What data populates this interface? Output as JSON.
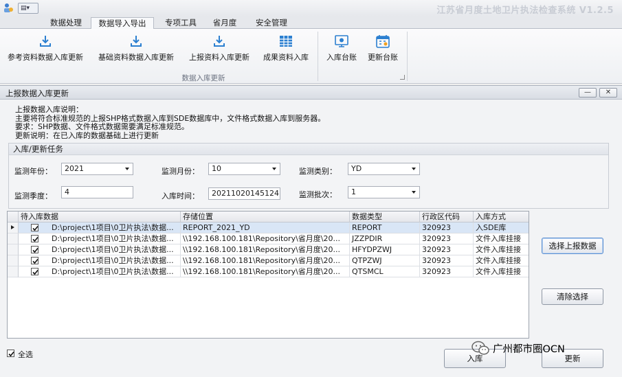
{
  "app": {
    "title": "江苏省月度土地卫片执法检查系统 V1.2.5",
    "quick_access": "▤▾"
  },
  "ribbon": {
    "tabs": [
      {
        "label": "数据处理",
        "active": false
      },
      {
        "label": "数据导入导出",
        "active": true
      },
      {
        "label": "专项工具",
        "active": false
      },
      {
        "label": "省月度",
        "active": false
      },
      {
        "label": "安全管理",
        "active": false
      }
    ],
    "buttons": [
      {
        "label": "参考资料数据入库更新",
        "icon": "download-icon"
      },
      {
        "label": "基础资料数据入库更新",
        "icon": "download-icon"
      },
      {
        "label": "上报资料入库更新",
        "icon": "download-icon"
      },
      {
        "label": "成果资料入库",
        "icon": "table-icon"
      },
      {
        "label": "入库台账",
        "icon": "monitor-icon"
      },
      {
        "label": "更新台账",
        "icon": "calendar-icon"
      }
    ],
    "group_label": "数据入库更新"
  },
  "dialog": {
    "title": "上报数据入库更新",
    "minimize": "—",
    "close": "✕",
    "notes": [
      "上报数据入库说明：",
      "主要将符合标准规范的上报SHP格式数据入库到SDE数据库中，文件格式数据入库到服务器。",
      "要求：SHP数据、文件格式数据需要满足标准规范。",
      "更新说明：在已入库的数据基础上进行更新"
    ],
    "task": {
      "title": "入库/更新任务",
      "year_label": "监测年份：",
      "year_value": "2021",
      "month_label": "监测月份：",
      "month_value": "10",
      "type_label": "监测类别：",
      "type_value": "YD",
      "quarter_label": "监测季度：",
      "quarter_value": "4",
      "time_label": "入库时间：",
      "time_value": "20211020145124",
      "batch_label": "监测批次：",
      "batch_value": "1"
    },
    "grid": {
      "columns": [
        "待入库数据",
        "存储位置",
        "数据类型",
        "行政区代码",
        "入库方式"
      ],
      "rows": [
        {
          "checked": true,
          "data": "D:\\project\\1项目\\0卫片执法\\数据...",
          "location": "REPORT_2021_YD",
          "type": "REPORT",
          "code": "320923",
          "method": "入SDE库"
        },
        {
          "checked": true,
          "data": "D:\\project\\1项目\\0卫片执法\\数据...",
          "location": "\\\\192.168.100.181\\Repository\\省月度\\20...",
          "type": "JZZPDIR",
          "code": "320923",
          "method": "文件入库挂接"
        },
        {
          "checked": true,
          "data": "D:\\project\\1项目\\0卫片执法\\数据...",
          "location": "\\\\192.168.100.181\\Repository\\省月度\\20...",
          "type": "HFYDPZWJ",
          "code": "320923",
          "method": "文件入库挂接"
        },
        {
          "checked": true,
          "data": "D:\\project\\1项目\\0卫片执法\\数据...",
          "location": "\\\\192.168.100.181\\Repository\\省月度\\20...",
          "type": "QTPZWJ",
          "code": "320923",
          "method": "文件入库挂接"
        },
        {
          "checked": true,
          "data": "D:\\project\\1项目\\0卫片执法\\数据...",
          "location": "\\\\192.168.100.181\\Repository\\省月度\\20...",
          "type": "QTSMCL",
          "code": "320923",
          "method": "文件入库挂接"
        }
      ]
    },
    "select_report_button": "选择上报数据",
    "clear_button": "清除选择",
    "select_all_label": "全选",
    "select_all_checked": true,
    "import_button": "入库",
    "update_button": "更新"
  },
  "overlay": {
    "wechat_label": "广州都市圈OCN",
    "wechat_icon": "wechat-icon"
  },
  "colors": {
    "selected_row": "#d9e6f6",
    "ribbon_icon": "#2b7fd0"
  }
}
